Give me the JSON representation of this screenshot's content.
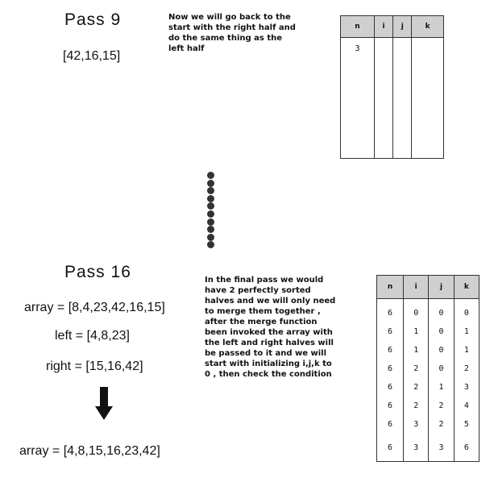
{
  "pass9": {
    "title": "Pass 9",
    "array": "[42,16,15]",
    "note": "Now we will go back to the start with the right half and do the same thing as the left half",
    "table": {
      "headers": [
        "n",
        "i",
        "j",
        "k"
      ],
      "rows": [
        [
          "3",
          "",
          "",
          ""
        ]
      ]
    }
  },
  "pass16": {
    "title": "Pass 16",
    "array_line": "array = [8,4,23,42,16,15]",
    "left_line": "left = [4,8,23]",
    "right_line": "right = [15,16,42]",
    "result_line": "array = [4,8,15,16,23,42]",
    "note": "In the final pass we would have 2 perfectly sorted halves and we will only need to merge them together , after the merge function been invoked the array with the left and right halves will be passed to it and we will start with initializing i,j,k to 0 , then check the condition",
    "table": {
      "headers": [
        "n",
        "i",
        "j",
        "k"
      ],
      "rows": [
        [
          "6",
          "0",
          "0",
          "0"
        ],
        [
          "6",
          "1",
          "0",
          "1"
        ],
        [
          "6",
          "1",
          "0",
          "1"
        ],
        [
          "6",
          "2",
          "0",
          "2"
        ],
        [
          "6",
          "2",
          "1",
          "3"
        ],
        [
          "6",
          "2",
          "2",
          "4"
        ],
        [
          "6",
          "3",
          "2",
          "5"
        ],
        [
          "6",
          "3",
          "3",
          "6"
        ]
      ]
    }
  },
  "separator": {
    "dot_count": 10
  },
  "colors": {
    "header_fill": "#cfcfcf",
    "ink": "#111111"
  }
}
